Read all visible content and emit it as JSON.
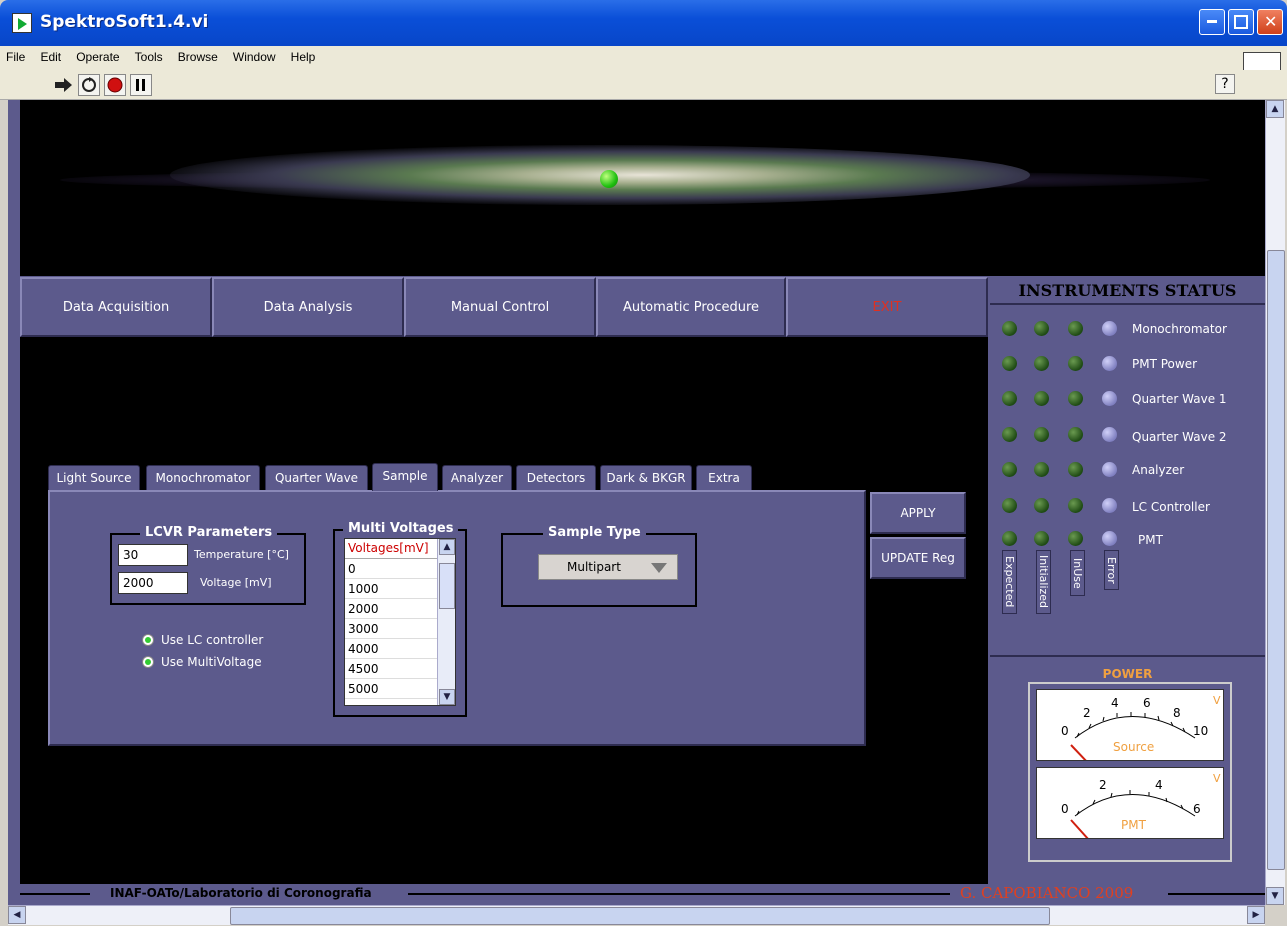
{
  "window": {
    "title": "SpektroSoft1.4.vi"
  },
  "menu": [
    "File",
    "Edit",
    "Operate",
    "Tools",
    "Browse",
    "Window",
    "Help"
  ],
  "nav": [
    "Data Acquisition",
    "Data Analysis",
    "Manual Control",
    "Automatic Procedure",
    "EXIT"
  ],
  "tabs": [
    "Light Source",
    "Monochromator",
    "Quarter Wave",
    "Sample",
    "Analyzer",
    "Detectors",
    "Dark & BKGR",
    "Extra"
  ],
  "active_tab": "Sample",
  "lcvr": {
    "title": "LCVR Parameters",
    "temperature_value": "30",
    "temperature_label": "Temperature [°C]",
    "voltage_value": "2000",
    "voltage_label": "Voltage [mV]"
  },
  "options": {
    "use_lc": "Use LC controller",
    "use_multi": "Use MultiVoltage"
  },
  "multi": {
    "title": "Multi Voltages",
    "header": "Voltages[mV]",
    "items": [
      "0",
      "1000",
      "2000",
      "3000",
      "4000",
      "4500",
      "5000"
    ]
  },
  "sample_type": {
    "title": "Sample Type",
    "value": "Multipart"
  },
  "buttons": {
    "apply": "APPLY",
    "update": "UPDATE Reg"
  },
  "status": {
    "title": "INSTRUMENTS STATUS",
    "rows": [
      "Monochromator",
      "PMT Power",
      "Quarter Wave 1",
      "Quarter Wave 2",
      "Analyzer",
      "LC Controller",
      "PMT"
    ],
    "columns": [
      "Expected",
      "Initialized",
      "InUse",
      "Error"
    ]
  },
  "power": {
    "title": "POWER",
    "unit": "V",
    "source": {
      "label": "Source",
      "ticks": [
        "0",
        "2",
        "4",
        "6",
        "8",
        "10"
      ],
      "value": 0
    },
    "pmt": {
      "label": "PMT",
      "ticks": [
        "0",
        "2",
        "4",
        "6"
      ],
      "value": 0
    }
  },
  "footer": {
    "left": "INAF-OATo/Laboratorio di Coronografia",
    "right": "G. CAPOBIANCO 2009"
  },
  "colors": {
    "panel": "#5c5a8c",
    "exit": "#e03020",
    "accent": "#f0a040"
  }
}
